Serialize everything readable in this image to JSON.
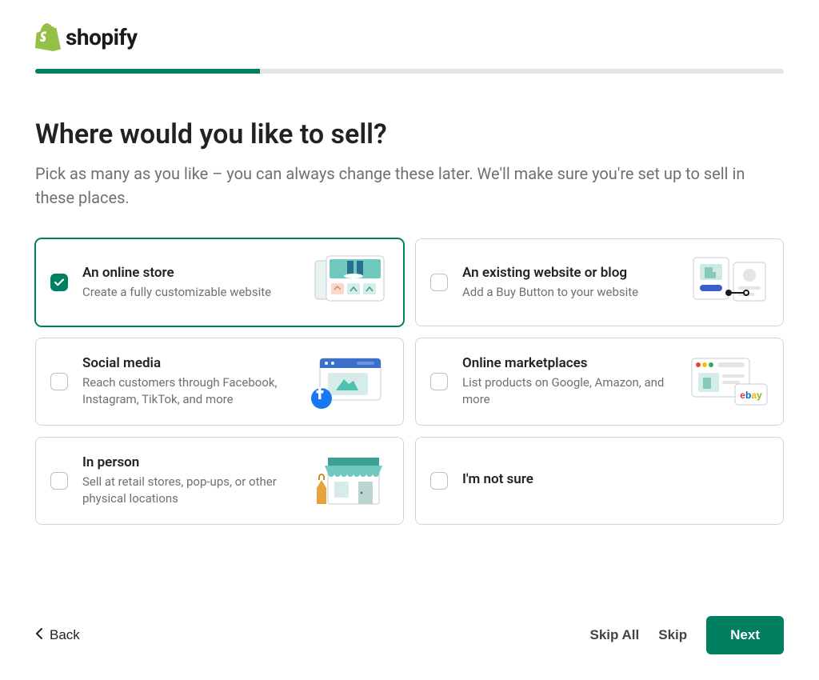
{
  "brand": {
    "name": "shopify"
  },
  "progress": {
    "percent": 30
  },
  "heading": "Where would you like to sell?",
  "subtitle": "Pick as many as you like – you can always change these later. We'll make sure you're set up to sell in these places.",
  "options": [
    {
      "title": "An online store",
      "desc": "Create a fully customizable website",
      "checked": true
    },
    {
      "title": "An existing website or blog",
      "desc": "Add a Buy Button to your website",
      "checked": false
    },
    {
      "title": "Social media",
      "desc": "Reach customers through Facebook, Instagram, TikTok, and more",
      "checked": false
    },
    {
      "title": "Online marketplaces",
      "desc": "List products on Google, Amazon, and more",
      "checked": false
    },
    {
      "title": "In person",
      "desc": "Sell at retail stores, pop-ups, or other physical locations",
      "checked": false
    },
    {
      "title": "I'm not sure",
      "desc": "",
      "checked": false
    }
  ],
  "footer": {
    "back": "Back",
    "skip_all": "Skip All",
    "skip": "Skip",
    "next": "Next"
  }
}
